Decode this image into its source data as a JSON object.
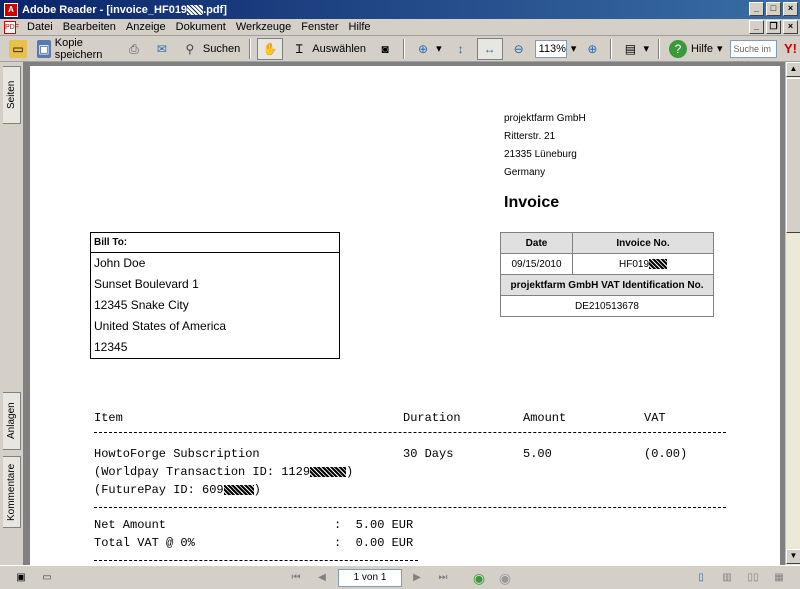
{
  "window": {
    "title": "Adobe Reader - [invoice_HF019",
    "title_suffix": ".pdf]"
  },
  "menu": [
    "Datei",
    "Bearbeiten",
    "Anzeige",
    "Dokument",
    "Werkzeuge",
    "Fenster",
    "Hilfe"
  ],
  "toolbar": {
    "save_label": "Kopie speichern",
    "search_label": "Suchen",
    "select_label": "Auswählen",
    "zoom_value": "113%",
    "help_label": "Hilfe",
    "web_search_placeholder": "Suche im Web"
  },
  "side_tabs": {
    "pages": "Seiten",
    "attachments": "Anlagen",
    "comments": "Kommentare"
  },
  "status": {
    "page_indicator": "1 von 1"
  },
  "invoice": {
    "company_lines": [
      "projektfarm GmbH",
      "Ritterstr. 21",
      "21335 Lüneburg",
      "Germany"
    ],
    "title": "Invoice",
    "bill_to_label": "Bill To:",
    "bill_to_lines": [
      "John Doe",
      "Sunset Boulevard 1",
      "12345 Snake City",
      "United States of America",
      "12345"
    ],
    "date_label": "Date",
    "invoice_no_label": "Invoice No.",
    "date_value": "09/15/2010",
    "invoice_no_value": "HF019",
    "vat_id_label": "projektfarm GmbH VAT Identification No.",
    "vat_id_value": "DE210513678",
    "col_item": "Item",
    "col_duration": "Duration",
    "col_amount": "Amount",
    "col_vat": "VAT",
    "line_item": "HowtoForge Subscription",
    "line_duration": "30 Days",
    "line_amount": "5.00",
    "line_vat": "(0.00)",
    "worldpay_prefix": "(Worldpay Transaction ID: 1129",
    "futurepay_prefix": "(FuturePay ID: 609",
    "net_label": "Net Amount",
    "net_value": ":  5.00 EUR",
    "vat_total_label": "Total VAT @ 0%",
    "vat_total_value": ":  0.00 EUR"
  }
}
